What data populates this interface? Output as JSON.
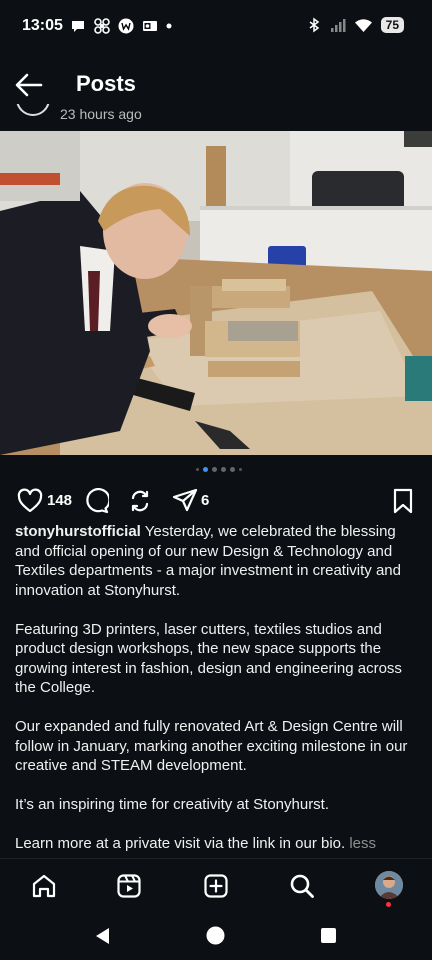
{
  "status_bar": {
    "time": "13:05",
    "battery": "75",
    "left_icons": [
      "chat-bubble-icon",
      "pinwheel-icon",
      "w-app-icon",
      "outlook-icon",
      "dot-icon"
    ],
    "right_icons": [
      "bluetooth-icon",
      "signal-icon",
      "wifi-icon",
      "battery-icon"
    ]
  },
  "header": {
    "title": "Posts",
    "back_icon": "arrow-left-icon"
  },
  "post": {
    "time_ago": "23 hours ago",
    "image_icon": "photo",
    "carousel": {
      "count": 6,
      "active_index": 1
    },
    "likes": "148",
    "shares": "6",
    "username": "stonyhurstofficial",
    "caption_first": "Yesterday, we celebrated the blessing and official opening of our new Design & Technology and Textiles departments - a major investment in creativity and innovation at Stonyhurst.",
    "paragraphs": [
      "Featuring 3D printers, laser cutters, textiles studios and product design workshops, the new space supports the growing interest in fashion, design and engineering across the College.",
      "Our expanded and fully renovated Art & Design Centre will follow in January, marking another exciting milestone in our creative and STEAM development.",
      "It’s an inspiring time for creativity at Stonyhurst."
    ],
    "last_line": "Learn more at a private visit via the link in our bio.",
    "less_label": "less"
  },
  "bottom_nav": [
    "home-icon",
    "reels-icon",
    "create-icon",
    "search-icon",
    "profile-avatar"
  ],
  "colors": {
    "background": "#0c1014",
    "accent": "#3897f0",
    "muted": "#8e8e8e",
    "notification": "#ff3040"
  }
}
